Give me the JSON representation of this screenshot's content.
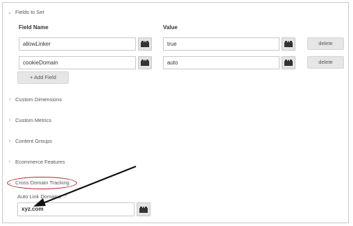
{
  "fields_to_set": {
    "header": "Fields to Set",
    "col_field_name": "Field Name",
    "col_value": "Value",
    "rows": [
      {
        "name": "allowLinker",
        "value": "true",
        "delete_label": "delete"
      },
      {
        "name": "cookieDomain",
        "value": "auto",
        "delete_label": "delete"
      }
    ],
    "add_label": "+ Add Field"
  },
  "sections": {
    "custom_dimensions": "Custom Dimensions",
    "custom_metrics": "Custom Metrics",
    "content_groups": "Content Groups",
    "ecommerce_features": "Ecommerce Features",
    "cross_domain_tracking": "Cross Domain Tracking"
  },
  "cross_domain": {
    "auto_link_label": "Auto Link Domains",
    "help_icon": "?",
    "auto_link_value": "xyz.com"
  },
  "icons": {
    "expanded": "chevron-down-icon",
    "collapsed": "chevron-right-icon",
    "variable": "variable-picker-icon"
  },
  "colors": {
    "highlight": "#b3262d",
    "arrow": "#111111"
  }
}
